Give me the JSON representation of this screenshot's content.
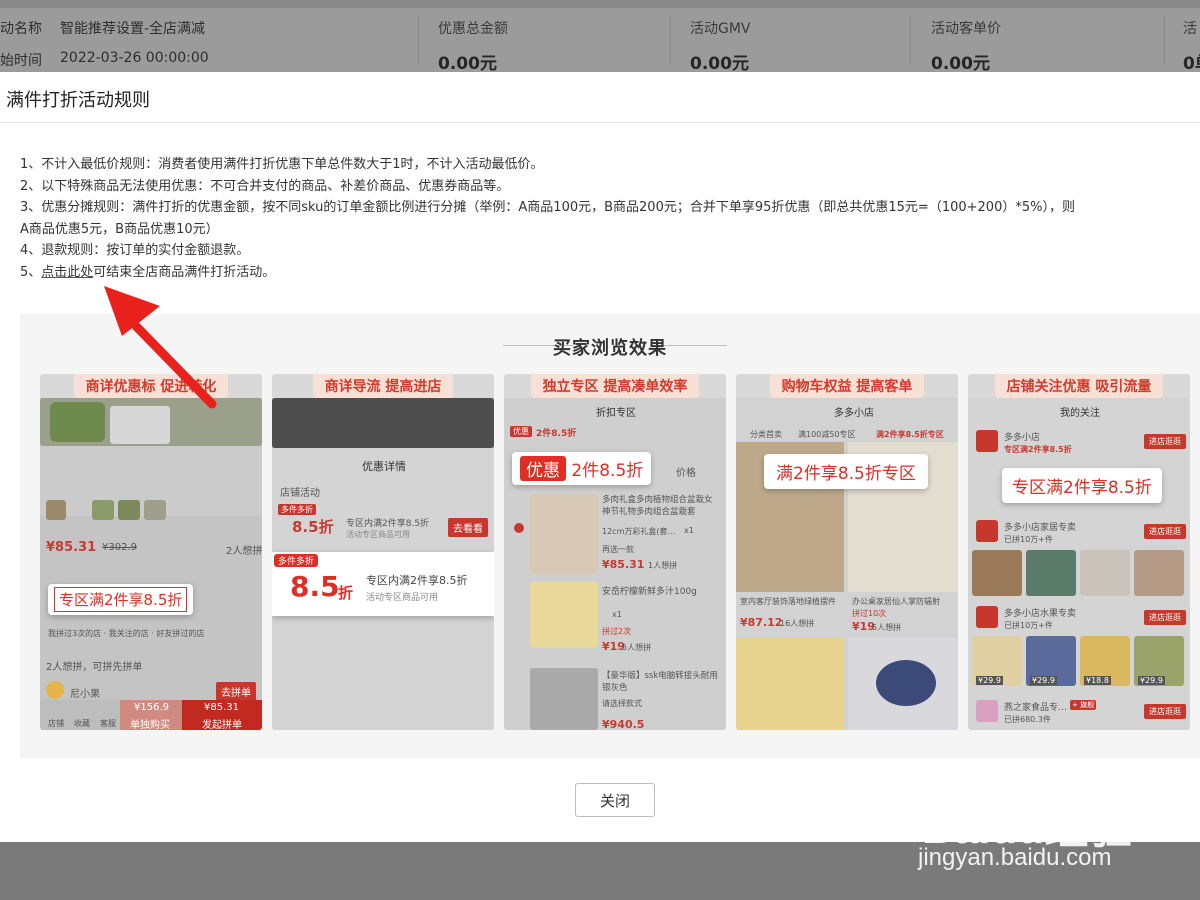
{
  "background": {
    "activity_name_label": "动名称",
    "activity_name_value": "智能推荐设置-全店满减",
    "start_time_label": "始时间",
    "start_time_value": "2022-03-26 00:00:00",
    "stats": [
      {
        "label": "优惠总金额",
        "value": "0.00元"
      },
      {
        "label": "活动GMV",
        "value": "0.00元"
      },
      {
        "label": "活动客单价",
        "value": "0.00元"
      },
      {
        "label": "活",
        "value": "0单"
      }
    ]
  },
  "modal": {
    "title": "满件打折活动规则",
    "rules": [
      "1、不计入最低价规则：消费者使用满件打折优惠下单总件数大于1时，不计入活动最低价。",
      "2、以下特殊商品无法使用优惠：不可合并支付的商品、补差价商品、优惠券商品等。",
      "3、优惠分摊规则：满件打折的优惠金额，按不同sku的订单金额比例进行分摊（举例：A商品100元，B商品200元；合并下单享95折优惠（即总共优惠15元=（100+200）*5%），则",
      "A商品优惠5元，B商品优惠10元）",
      "4、退款规则：按订单的实付金额退款。"
    ],
    "rule5_prefix": "5、",
    "rule5_link": "点击此处",
    "rule5_suffix": "可结束全店商品满件打折活动。",
    "preview_title": "买家浏览效果",
    "close_label": "关闭"
  },
  "cards": [
    {
      "header": "商详优惠标 促进转化",
      "price": "¥85.31",
      "price_old": "¥302.9",
      "buyers": "2人想拼",
      "callout": "专区满2件享8.5折",
      "visited": "我拼过3次的店 · 我关注的店 · 好友拼过的店",
      "group_hint": "2人想拼，可拼先拼单",
      "user": "尼小果",
      "join": "去拼单",
      "nav_store": "店铺",
      "nav_fav": "收藏",
      "nav_service": "客服",
      "single_price": "¥156.9",
      "single_label": "单独购买",
      "group_price": "¥85.31",
      "group_label": "发起拼单"
    },
    {
      "header": "商详导流 提高进店",
      "panel_title": "优惠详情",
      "section": "店铺活动",
      "tag": "多件多折",
      "discount_small": "8.5折",
      "desc_small": "专区内满2件享8.5折",
      "sub_small": "活动专区商品可用",
      "go": "去看看",
      "tag_big": "多件多折",
      "discount_big": "8.5",
      "discount_unit": "折",
      "desc_big": "专区内满2件享8.5折",
      "sub_big": "活动专区商品可用"
    },
    {
      "header": "独立专区 提高凑单效率",
      "nav_title": "折扣专区",
      "chip_tag": "优惠",
      "chip_text": "2件8.5折",
      "callout_tag": "优惠",
      "callout_text": "2件8.5折",
      "price_col": "价格",
      "item1_title": "多肉礼盒多肉植物组合盆栽女神节礼物多肉组合盆栽套",
      "item1_spec": "12cm万彩礼盒(套…",
      "item1_qty": "x1",
      "item1_other": "再选一款",
      "item1_price": "¥85.31",
      "item1_sold": "1人想拼",
      "item2_title": "安岳柠檬新鲜多汁100g",
      "item2_qty": "x1",
      "item2_note": "拼过2次",
      "item2_price": "¥19",
      "item2_sold": "5人想拼",
      "item3_title": "【豪华版】ssk电脑转接头耐用银灰色",
      "item3_spec": "请选择款式",
      "item3_price": "¥940.5"
    },
    {
      "header": "购物车权益 提高客单",
      "store": "多多小店",
      "tab1": "分类首卖",
      "tab2": "满100减50专区",
      "tab3": "满2件享8.5折专区",
      "callout": "满2件享8.5折专区",
      "item1_title": "室内客厅装饰落地绿植摆件",
      "item1_price": "¥87.12",
      "item1_sold": "16人想拼",
      "item2_title": "办公桌家居仙人掌防辐射",
      "item2_note": "拼过10次",
      "item2_price": "¥19",
      "item2_sold": "5人想拼"
    },
    {
      "header": "店铺关注优惠 吸引流量",
      "nav_title": "我的关注",
      "store1": "多多小店",
      "store1_tag": "专区满2件享8.5折",
      "store1_btn": "进店逛逛",
      "callout": "专区满2件享8.5折",
      "store2": "多多小店家居专卖",
      "store2_sub": "已拼10万+件",
      "store2_btn": "进店逛逛",
      "store3": "多多小店水果专卖",
      "store3_sub": "已拼10万+件",
      "store3_btn": "进店逛逛",
      "p1": "¥29.9",
      "p2": "¥29.9",
      "p3": "¥18.8",
      "p4": "¥29.9",
      "store4": "燕之家食品专…",
      "store4_sub": "已拼680.3件",
      "store4_badge": "+ 旗舰",
      "store4_btn": "进店逛逛"
    }
  ],
  "watermark": {
    "brand": "Baidu经验",
    "url": "jingyan.baidu.com"
  }
}
